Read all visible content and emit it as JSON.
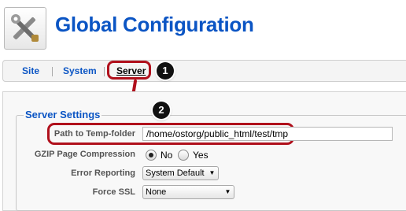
{
  "header": {
    "title": "Global Configuration",
    "icon": "tools-icon"
  },
  "tabs": [
    {
      "label": "Site"
    },
    {
      "label": "System"
    },
    {
      "label": "Server",
      "active": true
    }
  ],
  "annotations": {
    "step1": "1",
    "step2": "2",
    "highlight_color": "#b0101c"
  },
  "section": {
    "title": "Server Settings"
  },
  "fields": {
    "temp_folder": {
      "label": "Path to Temp-folder",
      "value": "/home/ostorg/public_html/test/tmp"
    },
    "gzip": {
      "label": "GZIP Page Compression",
      "options": [
        "No",
        "Yes"
      ],
      "selected": "No"
    },
    "error_reporting": {
      "label": "Error Reporting",
      "value": "System Default"
    },
    "force_ssl": {
      "label": "Force SSL",
      "value": "None"
    }
  },
  "colors": {
    "link_blue": "#0b55c4",
    "annotation_red": "#b0101c"
  }
}
